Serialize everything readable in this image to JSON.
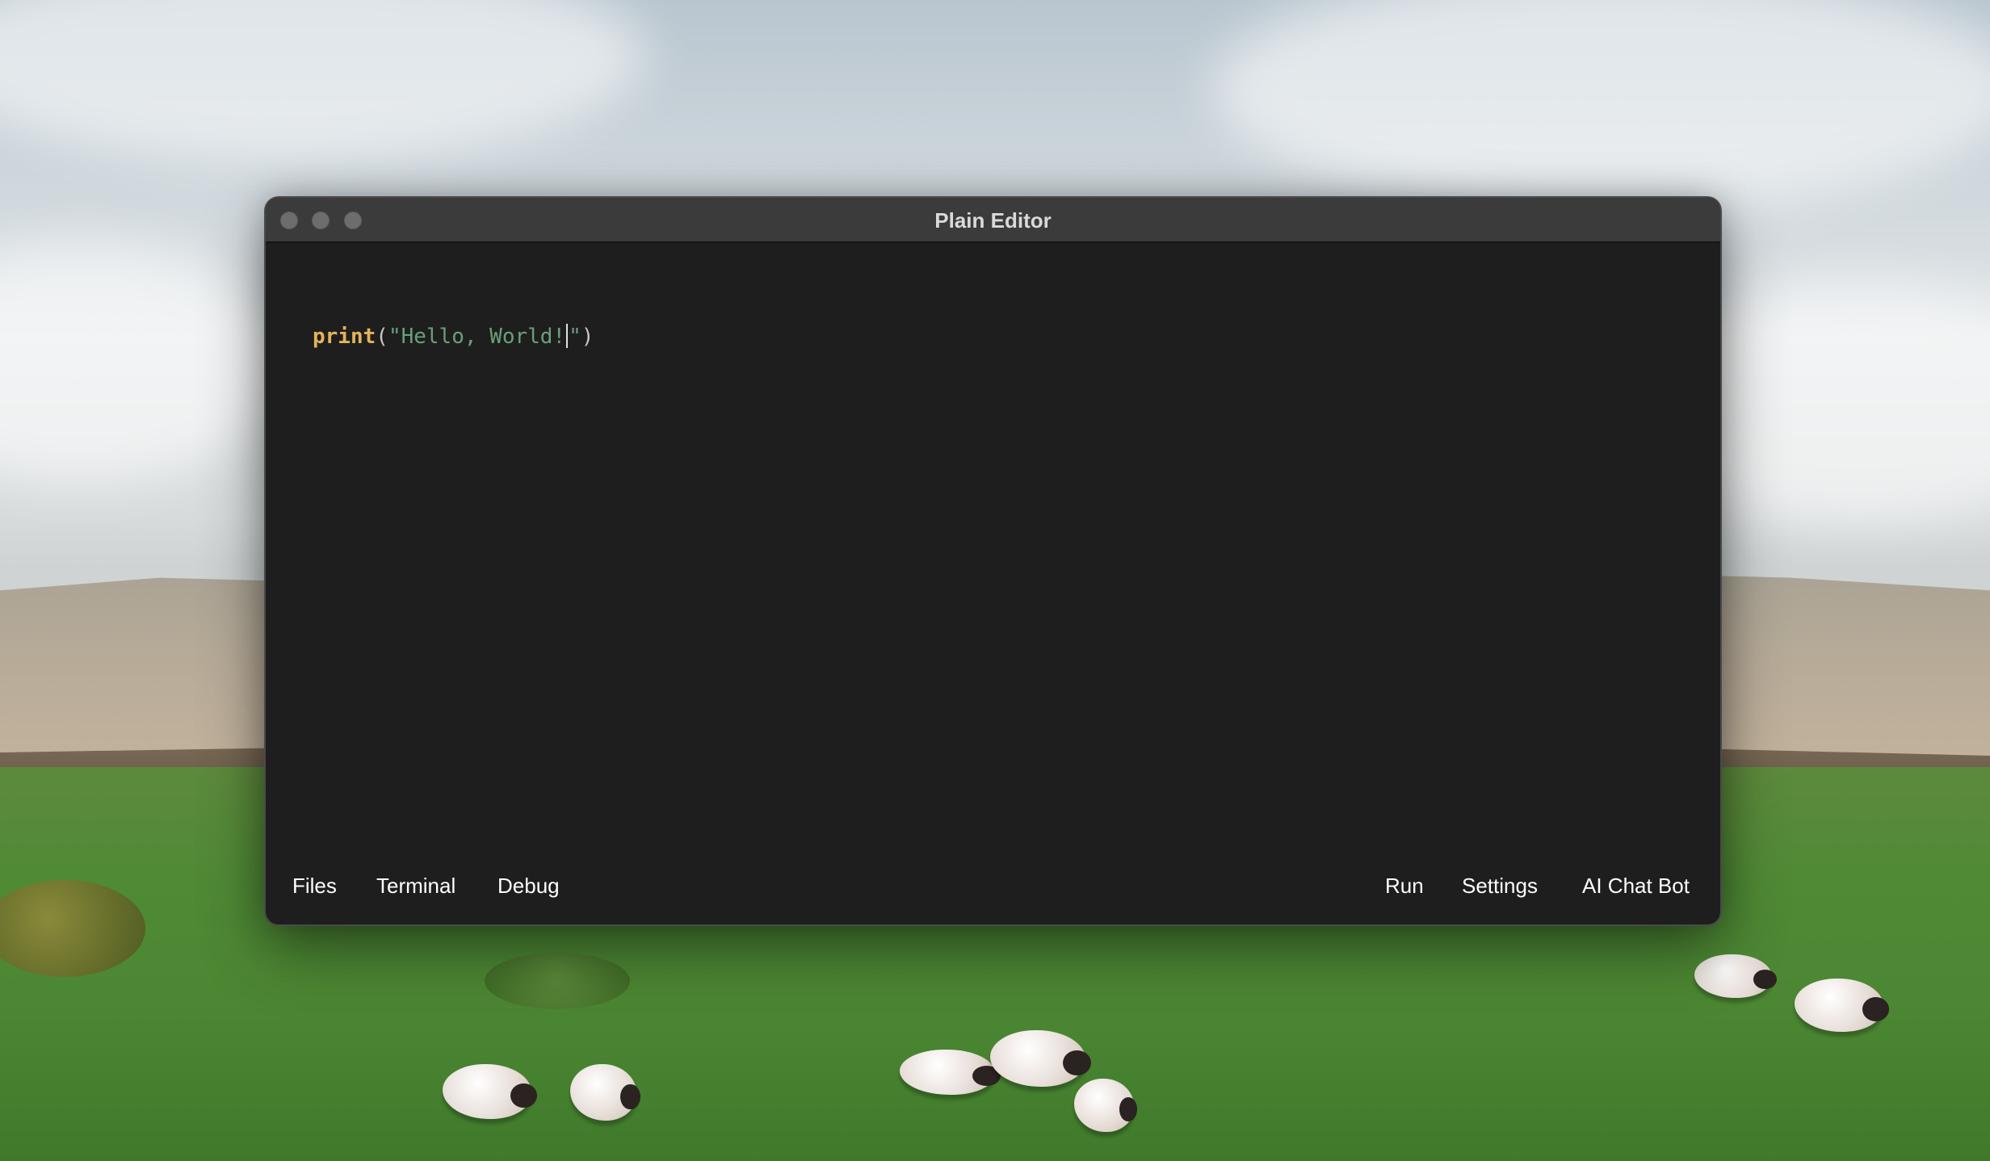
{
  "window": {
    "title": "Plain Editor"
  },
  "editor": {
    "code": {
      "function": "print",
      "open_paren": "(",
      "string_before_cursor": "\"Hello, World!",
      "string_after_cursor": "\"",
      "close_paren": ")"
    }
  },
  "toolbar": {
    "left": {
      "files_label": "Files",
      "terminal_label": "Terminal",
      "debug_label": "Debug"
    },
    "right": {
      "run_label": "Run",
      "settings_label": "Settings",
      "ai_chat_label": "AI Chat Bot"
    }
  },
  "colors": {
    "function": "#e5b25a",
    "string": "#6a9f7a",
    "editor_background": "#1e1e1e",
    "title_bar": "#3b3b3b"
  }
}
